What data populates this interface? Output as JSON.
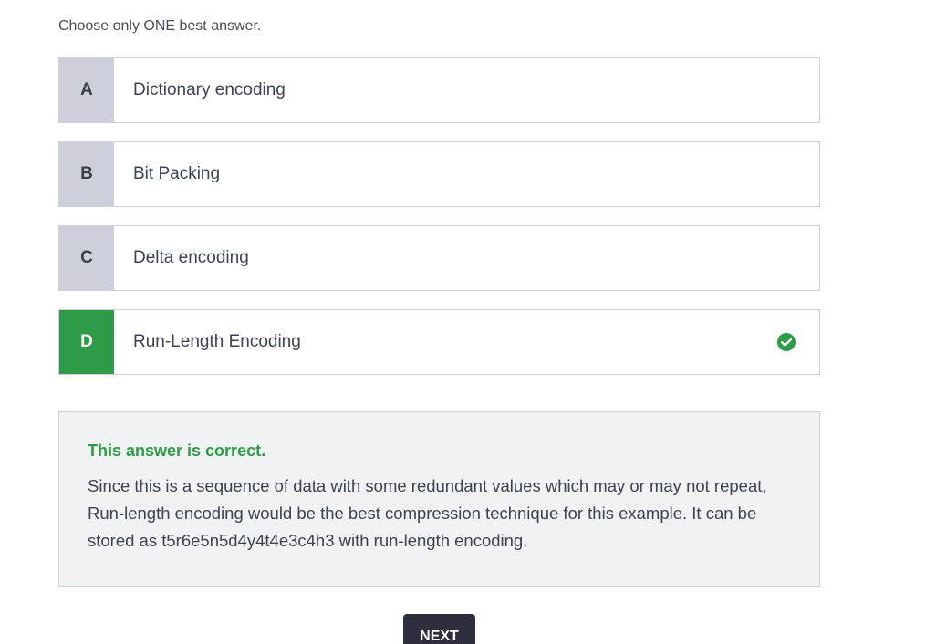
{
  "instruction": "Choose only ONE best answer.",
  "options": [
    {
      "letter": "A",
      "label": "Dictionary encoding",
      "state": "default"
    },
    {
      "letter": "B",
      "label": "Bit Packing",
      "state": "default"
    },
    {
      "letter": "C",
      "label": "Delta encoding",
      "state": "default"
    },
    {
      "letter": "D",
      "label": "Run-Length Encoding",
      "state": "correct",
      "icon": "check-circle-icon"
    }
  ],
  "feedback": {
    "title": "This answer is correct.",
    "body": "Since this is a sequence of data with some redundant values which may or may not repeat, Run-length encoding would be the best compression technique for this example. It can be stored as t5r6e5n5d4y4t4e3c4h3 with run-length encoding."
  },
  "next_label": "NEXT",
  "colors": {
    "correct": "#2e9c46",
    "letter_bg": "#cdd0da",
    "feedback_bg": "#f1f2f4",
    "button_bg": "#2d2f3d"
  }
}
